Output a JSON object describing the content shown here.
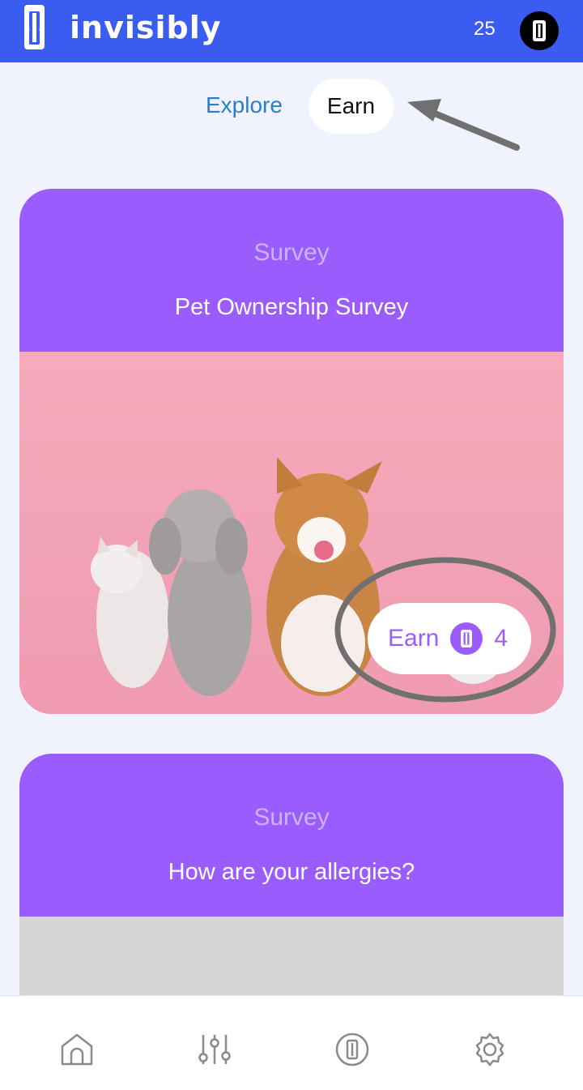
{
  "header": {
    "brand": "invisibly",
    "points": "25",
    "logo_icon": "invisibly-logo-icon",
    "avatar_icon": "invisibly-coin-icon"
  },
  "tabs": [
    {
      "label": "Explore",
      "active": false
    },
    {
      "label": "Earn",
      "active": true
    }
  ],
  "cards": [
    {
      "type": "Survey",
      "title": "Pet Ownership Survey",
      "image": "pets-on-pink-background",
      "earn_label": "Earn",
      "earn_value": "4"
    },
    {
      "type": "Survey",
      "title": "How are your allergies?",
      "image": "grey-background"
    }
  ],
  "bottom_nav": [
    {
      "icon": "home-icon"
    },
    {
      "icon": "sliders-icon"
    },
    {
      "icon": "invisibly-coin-icon"
    },
    {
      "icon": "gear-icon"
    }
  ],
  "colors": {
    "header_bg": "#3a5cf0",
    "card_purple": "#9b5cfd",
    "page_bg": "#f0f2fd",
    "explore_blue": "#2a80c7",
    "annotation_grey": "#707070"
  }
}
